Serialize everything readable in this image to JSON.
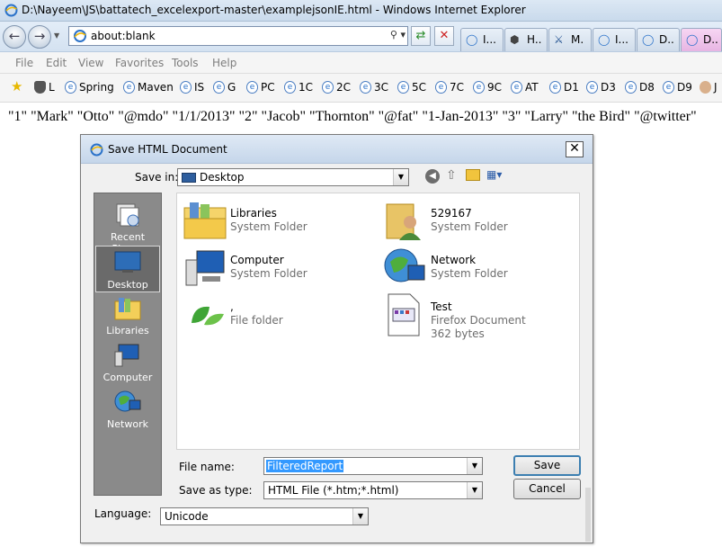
{
  "window": {
    "title": "D:\\Nayeem\\JS\\battatech_excelexport-master\\examplejsonIE.html - Windows Internet Explorer"
  },
  "address": {
    "url": "about:blank"
  },
  "tabs": [
    {
      "label": "I...",
      "icon": "ie-icon"
    },
    {
      "label": "H..",
      "icon": "shield-icon"
    },
    {
      "label": "M.",
      "icon": "figure-icon"
    },
    {
      "label": "I...",
      "icon": "ie-icon"
    },
    {
      "label": "D..",
      "icon": "ie-icon"
    },
    {
      "label": "D..",
      "icon": "ie-icon"
    }
  ],
  "menu": [
    "File",
    "Edit",
    "View",
    "Favorites",
    "Tools",
    "Help"
  ],
  "favorites": [
    {
      "label": "",
      "icon": "favorites-star-icon"
    },
    {
      "label": "L",
      "icon": "shield-icon"
    },
    {
      "label": "Spring",
      "icon": "ie-icon"
    },
    {
      "label": "Maven",
      "icon": "ie-icon"
    },
    {
      "label": "IS",
      "icon": "ie-icon"
    },
    {
      "label": "G",
      "icon": "ie-icon"
    },
    {
      "label": "PC",
      "icon": "ie-icon"
    },
    {
      "label": "1C",
      "icon": "ie-icon"
    },
    {
      "label": "2C",
      "icon": "ie-icon"
    },
    {
      "label": "3C",
      "icon": "ie-icon"
    },
    {
      "label": "5C",
      "icon": "ie-icon"
    },
    {
      "label": "7C",
      "icon": "ie-icon"
    },
    {
      "label": "9C",
      "icon": "ie-icon"
    },
    {
      "label": "AT",
      "icon": "ie-icon"
    },
    {
      "label": "D1",
      "icon": "ie-icon"
    },
    {
      "label": "D3",
      "icon": "ie-icon"
    },
    {
      "label": "D8",
      "icon": "ie-icon"
    },
    {
      "label": "D9",
      "icon": "ie-icon"
    },
    {
      "label": "J",
      "icon": "person-icon"
    }
  ],
  "page": {
    "text": "\"1\" \"Mark\" \"Otto\" \"@mdo\" \"1/1/2013\" \"2\" \"Jacob\" \"Thornton\" \"@fat\" \"1-Jan-2013\" \"3\" \"Larry\" \"the Bird\" \"@twitter\""
  },
  "dialog": {
    "title": "Save HTML Document",
    "save_in_label": "Save in:",
    "save_in_value": "Desktop",
    "places": [
      {
        "label": "Recent Places",
        "icon": "recent-places-icon",
        "selected": false
      },
      {
        "label": "Desktop",
        "icon": "desktop-icon",
        "selected": true
      },
      {
        "label": "Libraries",
        "icon": "libraries-icon",
        "selected": false
      },
      {
        "label": "Computer",
        "icon": "computer-icon",
        "selected": false
      },
      {
        "label": "Network",
        "icon": "network-icon",
        "selected": false
      }
    ],
    "files": [
      {
        "name": "Libraries",
        "type": "System Folder",
        "size": "",
        "icon": "libraries-folder-icon"
      },
      {
        "name": "529167",
        "type": "System Folder",
        "size": "",
        "icon": "user-folder-icon"
      },
      {
        "name": "Computer",
        "type": "System Folder",
        "size": "",
        "icon": "computer-icon"
      },
      {
        "name": "Network",
        "type": "System Folder",
        "size": "",
        "icon": "network-icon"
      },
      {
        "name": ",",
        "type": "File folder",
        "size": "",
        "icon": "leaf-folder-icon"
      },
      {
        "name": "Test",
        "type": "Firefox Document",
        "size": "362 bytes",
        "icon": "document-icon"
      }
    ],
    "file_name_label": "File name:",
    "file_name_value": "FilteredReport",
    "save_as_type_label": "Save as type:",
    "save_as_type_value": "HTML File (*.htm;*.html)",
    "language_label": "Language:",
    "language_value": "Unicode",
    "save_button": "Save",
    "cancel_button": "Cancel"
  }
}
